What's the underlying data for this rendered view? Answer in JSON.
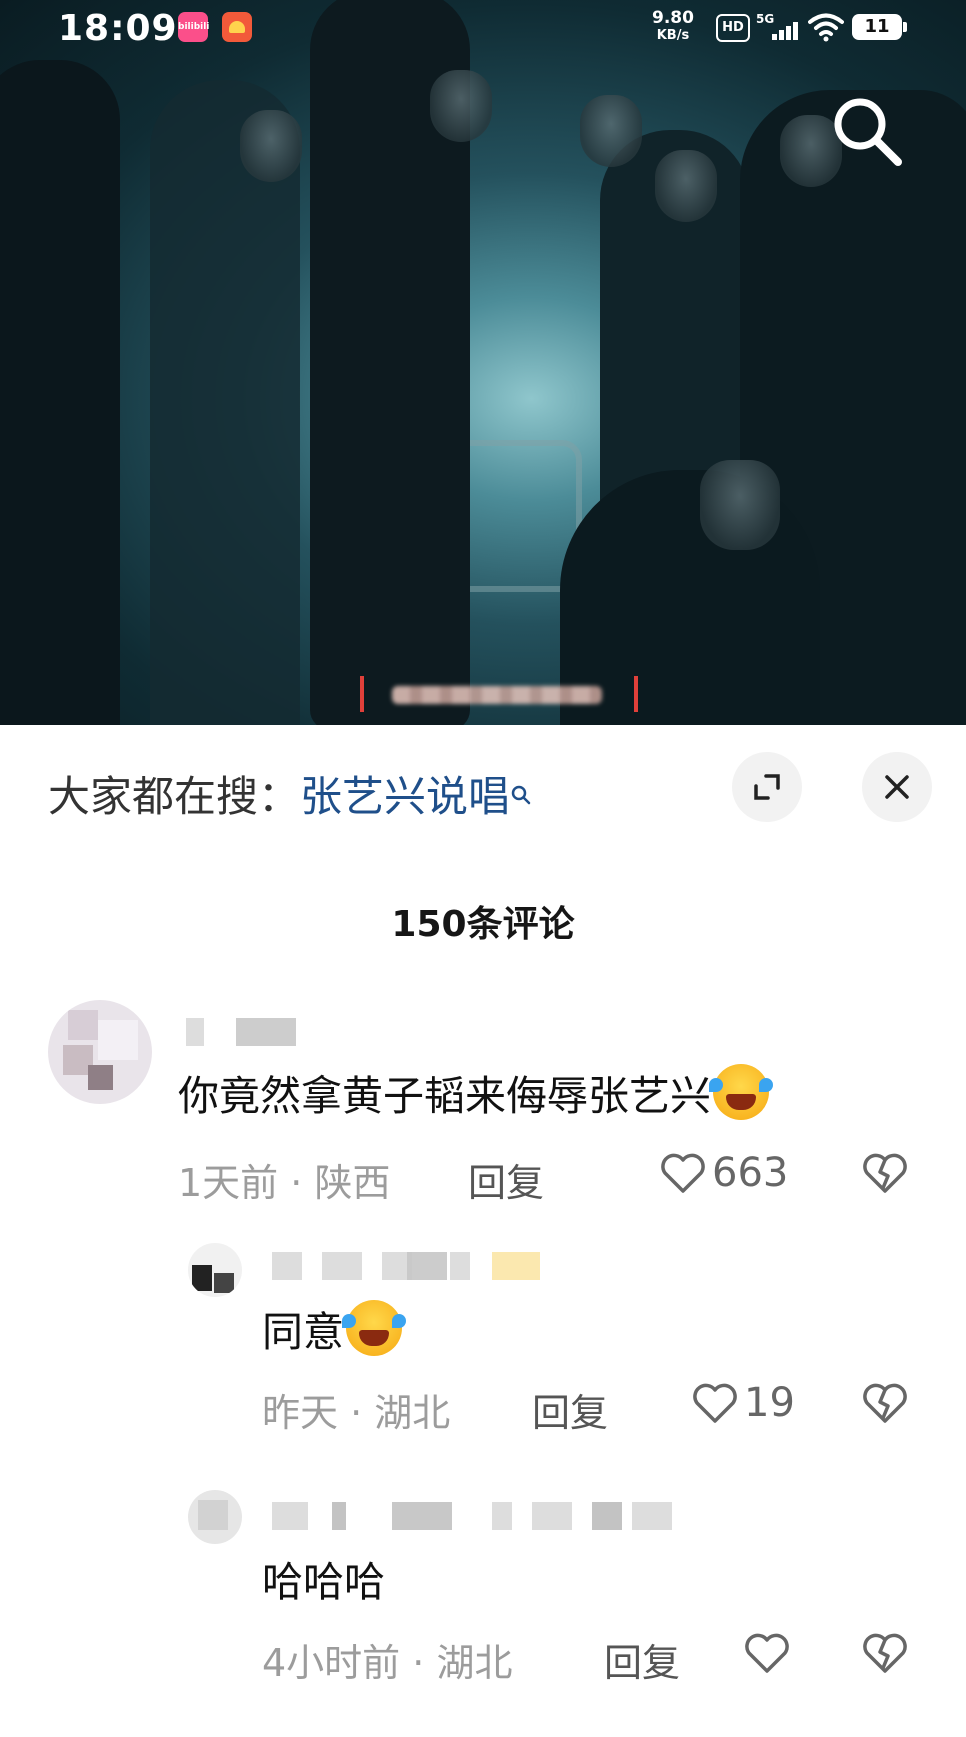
{
  "status_bar": {
    "time": "18:09",
    "net_speed": "9.80",
    "net_unit": "KB/s",
    "hd": "HD",
    "signal": "5G",
    "battery": "11",
    "app1_label": "bilibili"
  },
  "video": {
    "search_icon": "search-icon"
  },
  "hot_search": {
    "prefix": "大家都在搜：",
    "keyword": "张艺兴说唱",
    "keyword_icon": "search-icon"
  },
  "comments_count": "150条评论",
  "comments": [
    {
      "text": "你竟然拿黄子韬来侮辱张艺兴",
      "emoji": "laughing-crying-emoji",
      "time": "1天前",
      "location": "陕西",
      "reply_label": "回复",
      "likes": "663"
    },
    {
      "text": "同意",
      "emoji": "laughing-crying-emoji",
      "time": "昨天",
      "location": "湖北",
      "reply_label": "回复",
      "likes": "19"
    },
    {
      "text": "哈哈哈",
      "time": "4小时前",
      "location": "湖北",
      "reply_label": "回复",
      "likes": ""
    }
  ],
  "colors": {
    "keyword": "#1f4f8a",
    "meta": "#9c9c9c",
    "background": "#ffffff"
  }
}
